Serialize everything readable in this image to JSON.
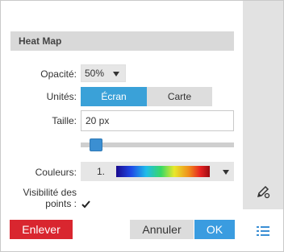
{
  "panel": {
    "title": "Heat Map"
  },
  "opacity": {
    "label": "Opacité:",
    "value": "50%"
  },
  "units": {
    "label": "Unités:",
    "options": [
      "Écran",
      "Carte"
    ],
    "selected": "Écran"
  },
  "size": {
    "label": "Taille:",
    "value": "20 px"
  },
  "slider": {
    "level_fraction": 0.08
  },
  "colors": {
    "label": "Couleurs:",
    "selected_index": "1.",
    "gradient_stops": [
      "#1a0a8f",
      "#1f49e6",
      "#1fbcea",
      "#38d865",
      "#e8e82a",
      "#f08b1a",
      "#e62222",
      "#9b0b12"
    ]
  },
  "points_visibility": {
    "label_line1": "Visibilité des",
    "label_line2": "points :",
    "checked": true
  },
  "buttons": {
    "remove": "Enlever",
    "cancel": "Annuler",
    "ok": "OK"
  },
  "side_icons": [
    "edit-pencil-icon",
    "list-icon"
  ],
  "colors_theme": {
    "accent": "#3aa1d8",
    "danger": "#d9262f",
    "ok": "#3a9ce0"
  }
}
